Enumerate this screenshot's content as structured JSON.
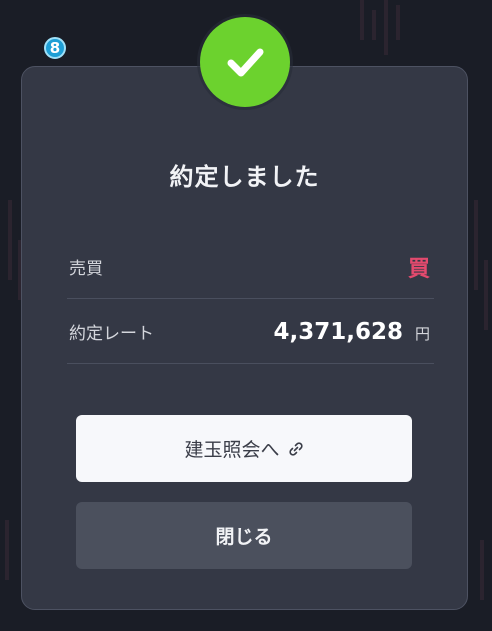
{
  "step_badge": "8",
  "dialog": {
    "title": "約定しました",
    "rows": [
      {
        "label": "売買",
        "value": "買"
      },
      {
        "label": "約定レート",
        "value": "4,371,628",
        "unit": "円"
      }
    ],
    "primary_button_label": "建玉照会へ",
    "close_button_label": "閉じる"
  },
  "colors": {
    "success_check": "#6cd22e",
    "buy_accent": "#e34a6e",
    "dialog_bg": "#343845",
    "step_badge_bg": "#1e9fd6"
  },
  "icons": {
    "success": "check-circle-icon",
    "link": "link-icon"
  }
}
